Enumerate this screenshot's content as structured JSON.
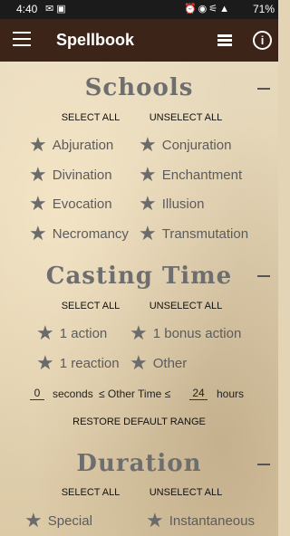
{
  "status": {
    "time": "4:40",
    "battery": "71%"
  },
  "appbar": {
    "title": "Spellbook"
  },
  "schools": {
    "heading": "Schools",
    "select_all": "SELECT ALL",
    "unselect_all": "UNSELECT ALL",
    "items": [
      "Abjuration",
      "Conjuration",
      "Divination",
      "Enchantment",
      "Evocation",
      "Illusion",
      "Necromancy",
      "Transmutation"
    ]
  },
  "casting": {
    "heading": "Casting Time",
    "select_all": "SELECT ALL",
    "unselect_all": "UNSELECT ALL",
    "items": [
      "1 action",
      "1 bonus action",
      "1 reaction",
      "Other"
    ],
    "min_value": "0",
    "min_unit": "seconds",
    "range_label": "≤ Other Time ≤",
    "max_value": "24",
    "max_unit": "hours",
    "restore": "RESTORE DEFAULT RANGE"
  },
  "duration": {
    "heading": "Duration",
    "select_all": "SELECT ALL",
    "unselect_all": "UNSELECT ALL",
    "items": [
      "Special",
      "Instantaneous"
    ]
  }
}
